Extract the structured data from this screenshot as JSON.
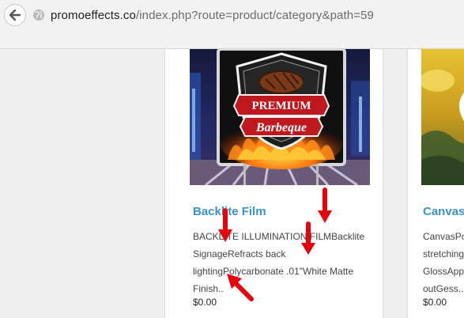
{
  "browser": {
    "url_domain": "promoeffects.co",
    "url_path": "/index.php?route=product/category&path=59"
  },
  "products": [
    {
      "title": "Backlite Film",
      "description_lines": [
        "BACKLITE ILLUMINATION FILMBacklite",
        "SignageRefracts back",
        "lightingPolycarbonate .01\"White Matte",
        "Finish.."
      ],
      "price": "$0.00",
      "sign_text_top": "PREMIUM",
      "sign_text_bottom": "Barbeque"
    },
    {
      "title": "Canvas",
      "description_lines": [
        "CanvasPo",
        "stretching",
        "GlossApp",
        "outGess.."
      ],
      "price": "$0.00"
    }
  ],
  "colors": {
    "link": "#3a93c8",
    "annotation_arrow": "#e8000b",
    "sign_red": "#c0181f"
  },
  "icons": {
    "back": "arrow-left-icon",
    "site": "globe-icon"
  }
}
